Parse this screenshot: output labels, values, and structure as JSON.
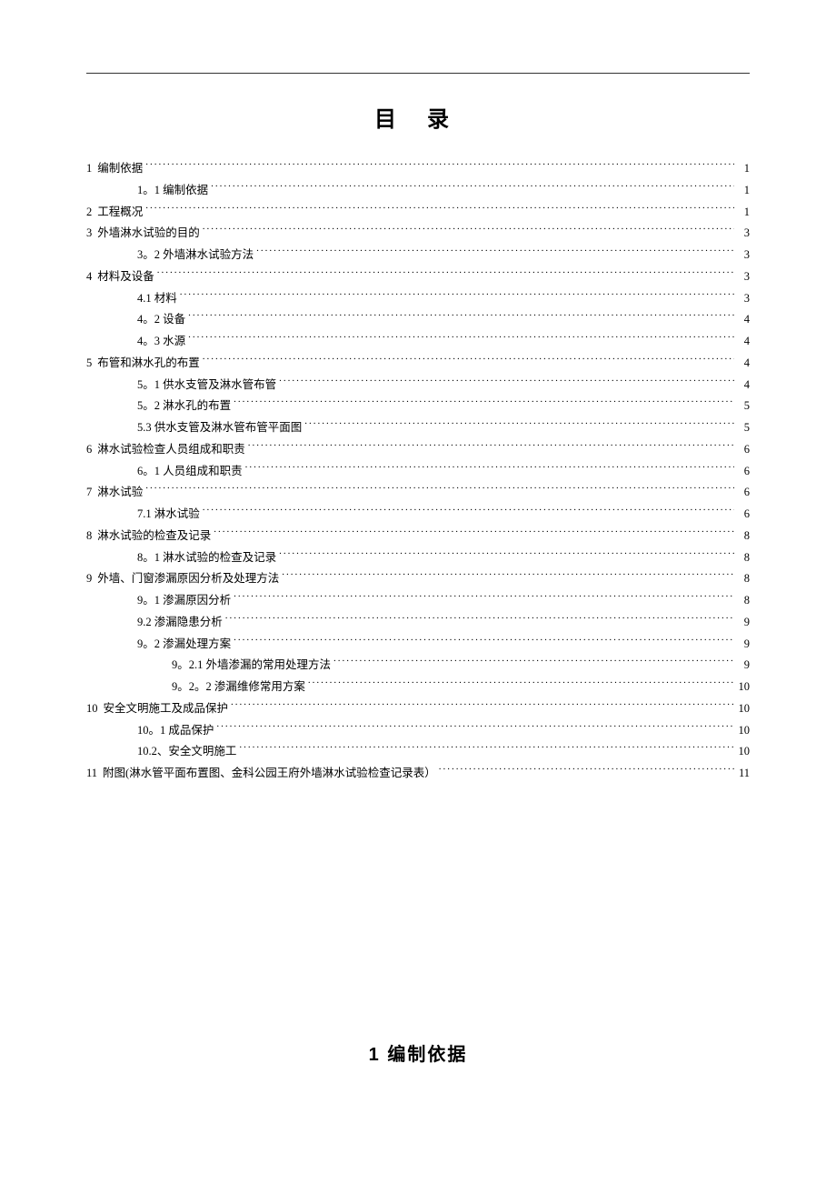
{
  "title": "目 录",
  "section_heading": "1  编制依据",
  "toc": [
    {
      "level": 1,
      "num": "1",
      "label": "编制依据",
      "page": "1"
    },
    {
      "level": 2,
      "num": "",
      "label": "1。1 编制依据",
      "page": "1"
    },
    {
      "level": 1,
      "num": "2",
      "label": "工程概况",
      "page": "1"
    },
    {
      "level": 1,
      "num": "3",
      "label": "外墙淋水试验的目的",
      "page": "3"
    },
    {
      "level": 2,
      "num": "",
      "label": "3。2 外墙淋水试验方法",
      "page": "3"
    },
    {
      "level": 1,
      "num": "4",
      "label": "材料及设备",
      "page": "3"
    },
    {
      "level": 2,
      "num": "",
      "label": "4.1 材料",
      "page": "3"
    },
    {
      "level": 2,
      "num": "",
      "label": "4。2 设备",
      "page": "4"
    },
    {
      "level": 2,
      "num": "",
      "label": "4。3 水源",
      "page": "4"
    },
    {
      "level": 1,
      "num": "5",
      "label": "布管和淋水孔的布置",
      "page": "4"
    },
    {
      "level": 2,
      "num": "",
      "label": "5。1 供水支管及淋水管布管",
      "page": "4"
    },
    {
      "level": 2,
      "num": "",
      "label": "5。2 淋水孔的布置",
      "page": "5"
    },
    {
      "level": 2,
      "num": "",
      "label": "5.3 供水支管及淋水管布管平面图",
      "page": "5"
    },
    {
      "level": 1,
      "num": "6",
      "label": "淋水试验检查人员组成和职责",
      "page": "6"
    },
    {
      "level": 2,
      "num": "",
      "label": "6。1 人员组成和职责",
      "page": "6"
    },
    {
      "level": 1,
      "num": "7",
      "label": "淋水试验",
      "page": "6"
    },
    {
      "level": 2,
      "num": "",
      "label": "7.1 淋水试验",
      "page": "6"
    },
    {
      "level": 1,
      "num": "8",
      "label": "淋水试验的检查及记录",
      "page": "8"
    },
    {
      "level": 2,
      "num": "",
      "label": "8。1 淋水试验的检查及记录",
      "page": "8"
    },
    {
      "level": 1,
      "num": "9",
      "label": "外墙、门窗渗漏原因分析及处理方法",
      "page": "8"
    },
    {
      "level": 2,
      "num": "",
      "label": "9。1 渗漏原因分析",
      "page": "8"
    },
    {
      "level": 2,
      "num": "",
      "label": "9.2 渗漏隐患分析",
      "page": "9"
    },
    {
      "level": 2,
      "num": "",
      "label": "9。2 渗漏处理方案",
      "page": "9"
    },
    {
      "level": 3,
      "num": "",
      "label": "9。2.1 外墙渗漏的常用处理方法",
      "page": "9"
    },
    {
      "level": 3,
      "num": "",
      "label": "9。2。2 渗漏维修常用方案",
      "page": "10"
    },
    {
      "level": 1,
      "num": "10",
      "label": "安全文明施工及成品保护",
      "page": "10"
    },
    {
      "level": 2,
      "num": "",
      "label": "10。1 成品保护",
      "page": "10"
    },
    {
      "level": 2,
      "num": "",
      "label": "10.2、安全文明施工",
      "page": "10"
    },
    {
      "level": 1,
      "num": "11",
      "label": "附图(淋水管平面布置图、金科公园王府外墙淋水试验检查记录表）",
      "page": "11"
    }
  ]
}
